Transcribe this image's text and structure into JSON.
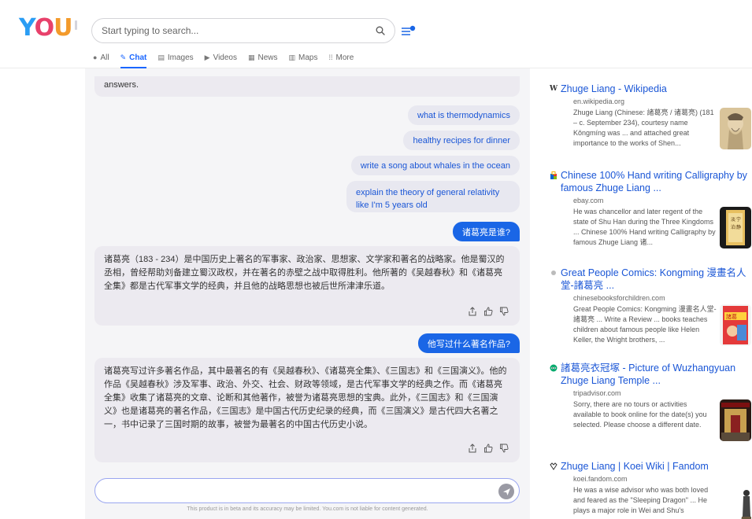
{
  "header": {
    "logo": "YOU",
    "search_placeholder": "Start typing to search...",
    "tabs": [
      {
        "label": "All",
        "icon": "grid-icon"
      },
      {
        "label": "Chat",
        "icon": "chat-icon",
        "active": true
      },
      {
        "label": "Images",
        "icon": "image-icon"
      },
      {
        "label": "Videos",
        "icon": "play-icon"
      },
      {
        "label": "News",
        "icon": "news-icon"
      },
      {
        "label": "Maps",
        "icon": "map-icon"
      },
      {
        "label": "More",
        "icon": "dots-icon"
      }
    ]
  },
  "chat": {
    "previous_tail": "answers.",
    "suggestions": [
      "what is thermodynamics",
      "healthy recipes for dinner",
      "write a song about whales in the ocean",
      "explain the theory of general relativity like I'm 5 years old"
    ],
    "messages": [
      {
        "question": "诸葛亮是谁?",
        "answer": "诸葛亮（183 - 234）是中国历史上著名的军事家、政治家、思想家、文学家和著名的战略家。他是蜀汉的丞相，曾经帮助刘备建立蜀汉政权，并在著名的赤壁之战中取得胜利。他所著的《吴越春秋》和《诸葛亮全集》都是古代军事文学的经典，并且他的战略思想也被后世所津津乐道。"
      },
      {
        "question": "他写过什么著名作品?",
        "answer": "诸葛亮写过许多著名作品，其中最著名的有《吴越春秋》、《诸葛亮全集》、《三国志》和《三国演义》。他的作品《吴越春秋》涉及军事、政治、外交、社会、财政等领域，是古代军事文学的经典之作。而《诸葛亮全集》收集了诸葛亮的文章、论断和其他著作，被誉为诸葛亮思想的宝典。此外，《三国志》和《三国演义》也是诸葛亮的著名作品，《三国志》是中国古代历史纪录的经典，而《三国演义》是古代四大名著之一，书中记录了三国时期的故事，被誉为最著名的中国古代历史小说。"
      }
    ],
    "input_value": "",
    "disclaimer": "This product is in beta and its accuracy may be limited. You.com is not liable for content generated."
  },
  "results": [
    {
      "title": "Zhuge Liang - Wikipedia",
      "favicon": "W",
      "url": "en.wikipedia.org",
      "snippet": "Zhuge Liang (Chinese: 諸葛亮 / 诸葛亮) (181 – c. September 234), courtesy name Kǒngmíng was ... and attached great importance to the works of Shen..."
    },
    {
      "title": "Chinese 100% Hand writing Calligraphy by famous Zhuge Liang ...",
      "favicon": "ebay-icon",
      "url": "ebay.com",
      "snippet": "He was chancellor and later regent of the state of Shu Han during the Three Kingdoms ... Chinese 100% Hand writing Calligraphy by famous Zhuge Liang 诸..."
    },
    {
      "title": "Great People Comics: Kongming 漫畫名人堂-諸葛亮 ...",
      "favicon": "globe-icon",
      "url": "chinesebooksforchildren.com",
      "snippet": "Great People Comics: Kongming 漫畫名人堂-諸葛亮 ... Write a Review ... books teaches children about famous people like Helen Keller, the Wright brothers, ..."
    },
    {
      "title": "諸葛亮衣冠塚 - Picture of Wuzhangyuan Zhuge Liang Temple ...",
      "favicon": "tripadvisor-icon",
      "url": "tripadvisor.com",
      "snippet": "Sorry, there are no tours or activities available to book online for the date(s) you selected. Please choose a different date."
    },
    {
      "title": "Zhuge Liang | Koei Wiki | Fandom",
      "favicon": "fandom-icon",
      "url": "koei.fandom.com",
      "snippet": "He was a wise advisor who was both loved and feared as the \"Sleeping Dragon\" ... He plays a major role in Wei and Shu's"
    }
  ],
  "colors": {
    "accent": "#1a66e6",
    "link": "#1a56d6",
    "chat_bg": "#f5f5f7",
    "card_bg": "#eceaf0"
  }
}
